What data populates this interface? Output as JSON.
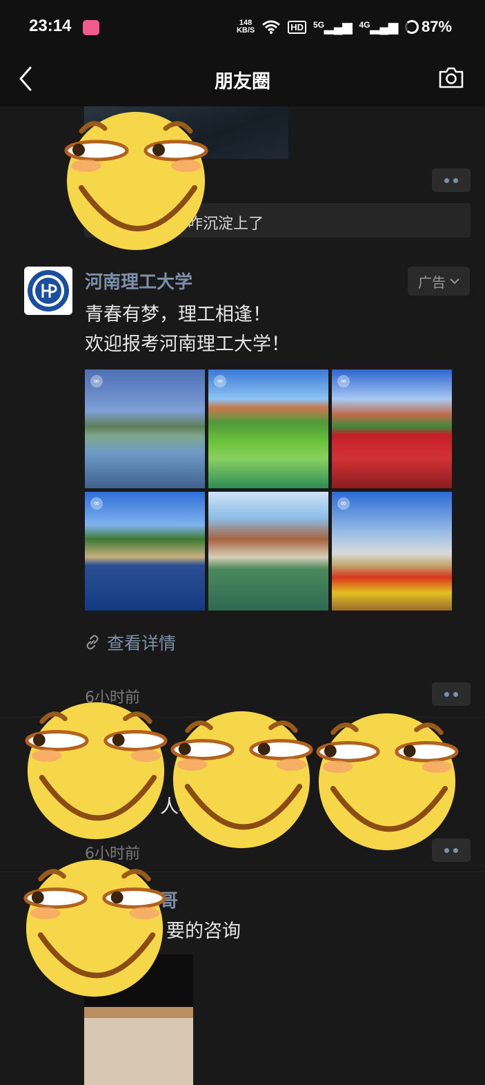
{
  "status_bar": {
    "time": "23:14",
    "net_speed_value": "148",
    "net_speed_unit": "KB/S",
    "hd_label": "HD",
    "signal_5g": "5G",
    "signal_4g": "4G",
    "battery": "87%"
  },
  "nav": {
    "title": "朋友圈",
    "back_icon": "chevron-left-icon",
    "camera_icon": "camera-icon"
  },
  "feed": {
    "post0": {
      "comment_visible": "咋沉淀上了"
    },
    "ad_post": {
      "name": "河南理工大学",
      "ad_label": "广告",
      "text_line1": "青春有梦，理工相逢！",
      "text_line2": "欢迎报考河南理工大学！",
      "photos": [
        "campus-lake",
        "campus-river",
        "flower-field",
        "bridge-reflection",
        "willow-building",
        "arch-gate"
      ],
      "detail_link": "查看详情",
      "time": "6小时前"
    },
    "post2": {
      "time": "6小时前",
      "visible_fragment": "人块"
    },
    "post3": {
      "name_fragment": "哥",
      "text_fragment": "要的咨询"
    }
  },
  "colors": {
    "background": "#191919",
    "link_blue": "#7d90a9",
    "sticker_yellow": "#f7d74a"
  }
}
